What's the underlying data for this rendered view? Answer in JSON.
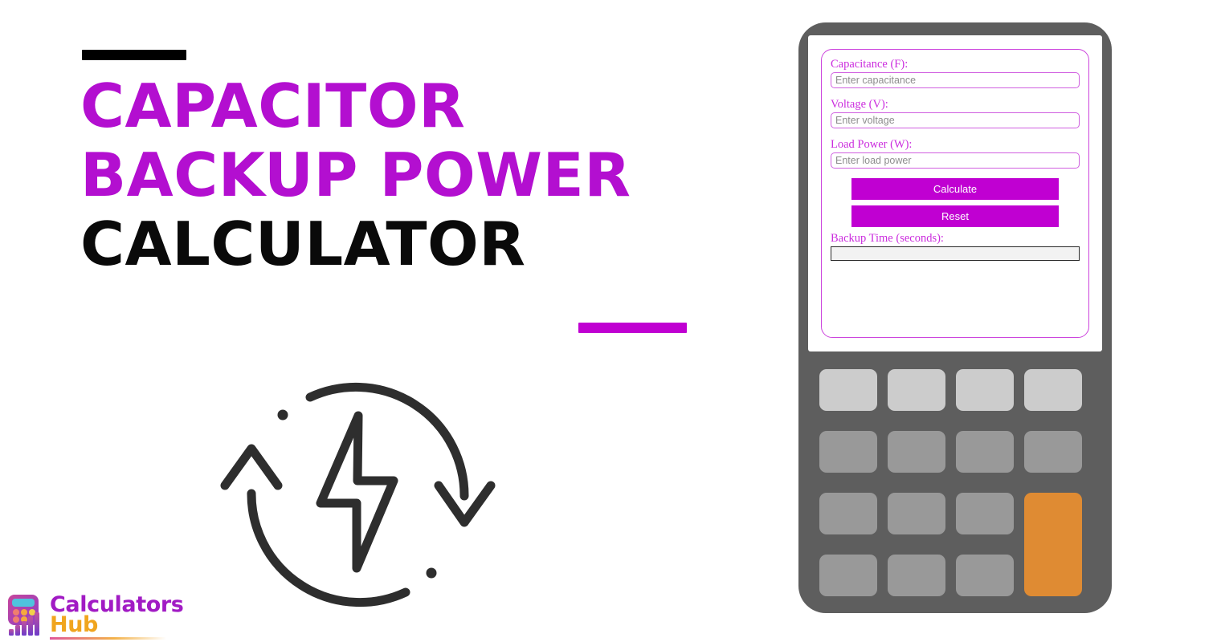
{
  "page": {
    "background": "#FFFFFF",
    "accent_purple": "#B30FD0",
    "accent_magenta": "#C000D2",
    "accent_black": "#000000"
  },
  "hero": {
    "title_lines": [
      {
        "text": "CAPACITOR",
        "color": "purple"
      },
      {
        "text": "BACKUP POWER",
        "color": "purple"
      },
      {
        "text": "CALCULATOR",
        "color": "black"
      }
    ],
    "icon_name": "lightning-bolt-refresh-cycle-icon"
  },
  "logo": {
    "word_1": "Calculators",
    "word_2": "Hub",
    "word_1_color": "#A11BC4",
    "word_2_color": "#F0A51E",
    "mark_name": "calculator-bar-chart-logo-icon"
  },
  "device": {
    "frame_color": "#5E5E5E",
    "screen_color": "#FFFFFF",
    "key_light_color": "#CCCCCC",
    "key_mid_color": "#999999",
    "key_accent_color": "#DF8B33",
    "keypad": {
      "rows": 4,
      "columns": 4,
      "keys": [
        {
          "tone": "light"
        },
        {
          "tone": "light"
        },
        {
          "tone": "light"
        },
        {
          "tone": "light"
        },
        {
          "tone": "mid"
        },
        {
          "tone": "mid"
        },
        {
          "tone": "mid"
        },
        {
          "tone": "mid"
        },
        {
          "tone": "mid"
        },
        {
          "tone": "mid"
        },
        {
          "tone": "mid"
        },
        {
          "tone": "accent"
        },
        {
          "tone": "mid"
        },
        {
          "tone": "mid"
        },
        {
          "tone": "mid"
        }
      ]
    }
  },
  "calculator_form": {
    "fields": [
      {
        "label": "Capacitance (F):",
        "placeholder": "Enter capacitance",
        "value": ""
      },
      {
        "label": "Voltage (V):",
        "placeholder": "Enter voltage",
        "value": ""
      },
      {
        "label": "Load Power (W):",
        "placeholder": "Enter load power",
        "value": ""
      }
    ],
    "buttons": {
      "calculate": "Calculate",
      "reset": "Reset"
    },
    "result": {
      "label": "Backup Time (seconds):",
      "value": "",
      "placeholder": ""
    },
    "label_color": "#CB2CDE",
    "input_border_color": "#D05FE0",
    "button_color": "#C000D2",
    "button_text_color": "#FFFFFF"
  }
}
